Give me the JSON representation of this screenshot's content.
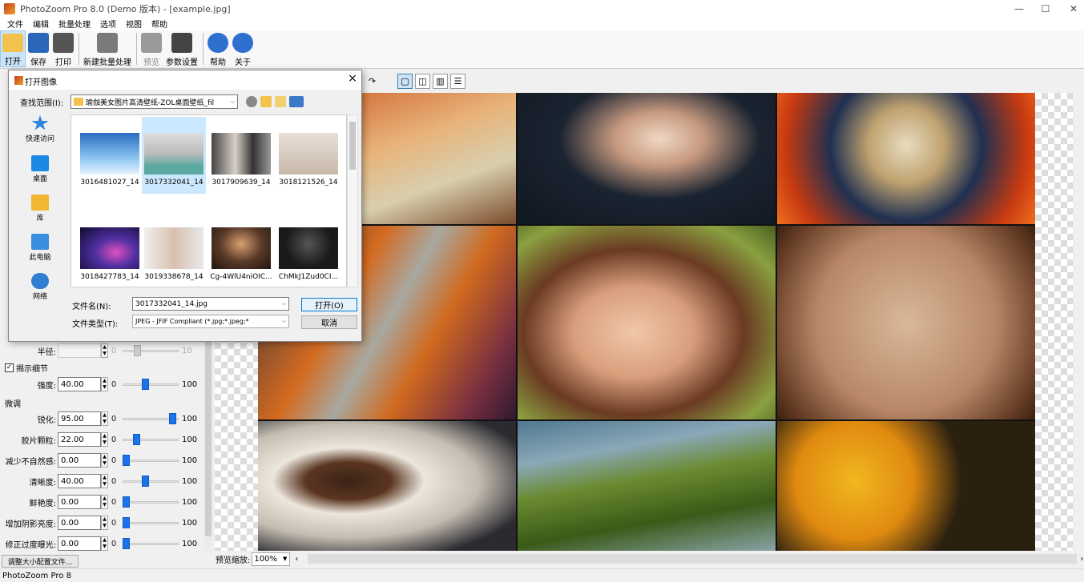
{
  "window": {
    "title": "PhotoZoom Pro 8.0 (Demo 版本) - [example.jpg]",
    "minimize": "—",
    "maximize": "☐",
    "close": "✕"
  },
  "menu": [
    "文件",
    "编辑",
    "批量处理",
    "选项",
    "视图",
    "帮助"
  ],
  "toolbar": [
    {
      "label": "打开",
      "icon": "folder-open-icon",
      "color": "#f2c14e"
    },
    {
      "label": "保存",
      "icon": "save-icon",
      "color": "#2b67b8"
    },
    {
      "label": "打印",
      "icon": "printer-icon",
      "color": "#555555"
    },
    {
      "label": "新建批量处理",
      "icon": "batch-icon",
      "color": "#7a7a7a"
    },
    {
      "label": "预览",
      "icon": "preview-icon",
      "color": "#9a9a9a"
    },
    {
      "label": "参数设置",
      "icon": "settings-tools-icon",
      "color": "#444444"
    },
    {
      "label": "帮助",
      "icon": "help-icon",
      "color": "#2f6fd0"
    },
    {
      "label": "关于",
      "icon": "info-icon",
      "color": "#2f6fd0"
    }
  ],
  "settings": {
    "radius_label": "半径:",
    "radius_min": "0",
    "radius_max": "10",
    "reveal_detail_label": "揭示细节",
    "strength_label": "强度:",
    "strength_value": "40.00",
    "finetune_label": "微调",
    "sharpen_label": "锐化:",
    "sharpen_value": "95.00",
    "grain_label": "胶片颗粒:",
    "grain_value": "22.00",
    "unnatural_label": "减少不自然感:",
    "unnatural_value": "0.00",
    "clarity_label": "清晰度:",
    "clarity_value": "40.00",
    "vividness_label": "鲜艳度:",
    "vividness_value": "0.00",
    "shadow_label": "增加阴影亮度:",
    "shadow_value": "0.00",
    "overexposure_label": "修正过度曝光:",
    "overexposure_value": "0.00",
    "min": "0",
    "max": "100",
    "levels": {
      "strength": 0.4,
      "sharpen": 0.95,
      "grain": 0.22,
      "unnatural": 0.0,
      "clarity": 0.4,
      "vividness": 0.0,
      "shadow": 0.0,
      "overexposure": 0.0
    },
    "resize_profile_button": "调整大小配置文件..."
  },
  "bottom": {
    "zoom_label": "预览缩放:",
    "zoom_value": "100%"
  },
  "status": "PhotoZoom Pro 8",
  "dialog": {
    "title": "打开图像",
    "look_in_label": "查找范围(I):",
    "look_in_value": "瑜伽美女图片高清壁纸-ZOL桌面壁纸_fil",
    "places": [
      "快速访问",
      "桌面",
      "库",
      "此电脑",
      "网络"
    ],
    "files": [
      "3016481027_14",
      "3017332041_14",
      "3017909639_14",
      "3018121526_14",
      "3018427783_14",
      "3019338678_14",
      "Cg-4WlU4niOIC...",
      "ChMkJ1Zud0CI..."
    ],
    "filename_label": "文件名(N):",
    "filename_value": "3017332041_14.jpg",
    "filetype_label": "文件类型(T):",
    "filetype_value": "JPEG - JFIF Compliant (*.jpg;*.jpeg;*",
    "open_button": "打开(O)",
    "cancel_button": "取消"
  }
}
